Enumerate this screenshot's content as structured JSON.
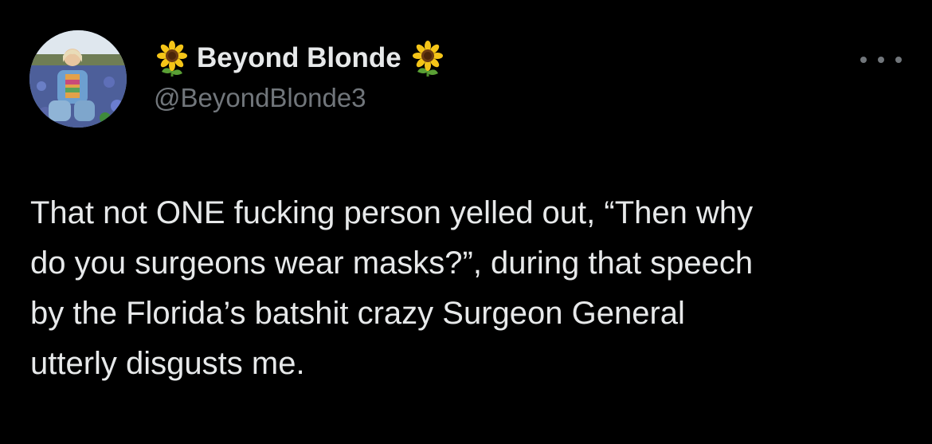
{
  "author": {
    "display_name": "Beyond Blonde",
    "handle": "@BeyondBlonde3",
    "name_emoji": "sunflower-icon"
  },
  "tweet": {
    "lines": [
      "That not ONE fucking person yelled out, “Then why",
      "do you surgeons wear masks?”, during that speech",
      "by the Florida’s batshit crazy Surgeon General",
      "utterly disgusts me."
    ]
  },
  "icons": {
    "more": "more-options-icon"
  },
  "colors": {
    "background": "#000000",
    "primary_text": "#e7e9ea",
    "secondary_text": "#71767b"
  }
}
